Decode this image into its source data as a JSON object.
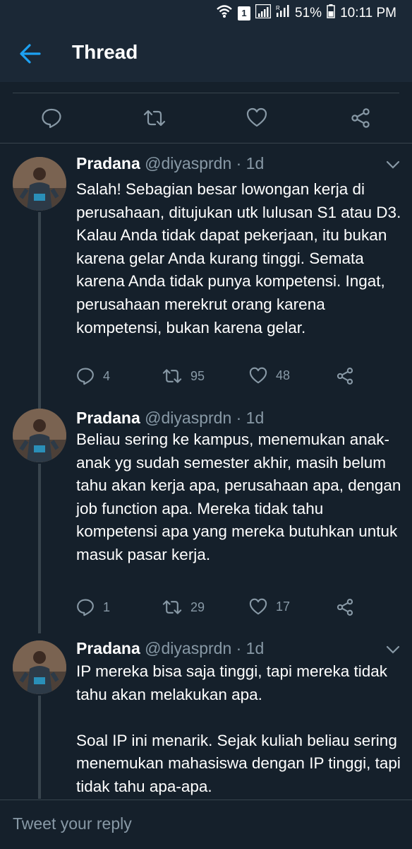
{
  "status_bar": {
    "sim_badge": "1",
    "battery": "51%",
    "time": "10:11 PM"
  },
  "app_bar": {
    "title": "Thread",
    "back_icon": "arrow-left-icon"
  },
  "colors": {
    "background": "#15202b",
    "bar_background": "#1b2836",
    "accent": "#1da1f2",
    "secondary_text": "#8899a6",
    "divider": "#38444d"
  },
  "icons": [
    "reply-icon",
    "retweet-icon",
    "like-icon",
    "share-icon",
    "chevron-down-icon"
  ],
  "tweets": [
    {
      "name": "Pradana",
      "handle": "@diyasprdn · 1d",
      "paragraphs": [
        "Salah! Sebagian besar lowongan kerja di perusahaan, ditujukan utk lulusan S1 atau D3. Kalau Anda tidak dapat pekerjaan, itu bukan karena gelar Anda kurang tinggi. Semata karena Anda tidak punya kompetensi. Ingat, perusahaan merekrut orang karena kompetensi, bukan karena gelar."
      ],
      "replies": "4",
      "retweets": "95",
      "likes": "48"
    },
    {
      "name": "Pradana",
      "handle": "@diyasprdn · 1d",
      "paragraphs": [
        "Beliau sering ke kampus, menemukan anak-anak yg sudah semester akhir, masih belum tahu akan kerja apa, perusahaan apa, dengan job function apa. Mereka tidak tahu kompetensi apa yang mereka butuhkan untuk masuk pasar kerja."
      ],
      "replies": "1",
      "retweets": "29",
      "likes": "17"
    },
    {
      "name": "Pradana",
      "handle": "@diyasprdn · 1d",
      "paragraphs": [
        "IP mereka bisa saja tinggi, tapi mereka tidak tahu akan melakukan apa.",
        "Soal IP ini menarik. Sejak kuliah beliau sering menemukan mahasiswa dengan IP tinggi, tapi tidak tahu apa-apa."
      ]
    }
  ],
  "reply_box": {
    "placeholder": "Tweet your reply"
  }
}
